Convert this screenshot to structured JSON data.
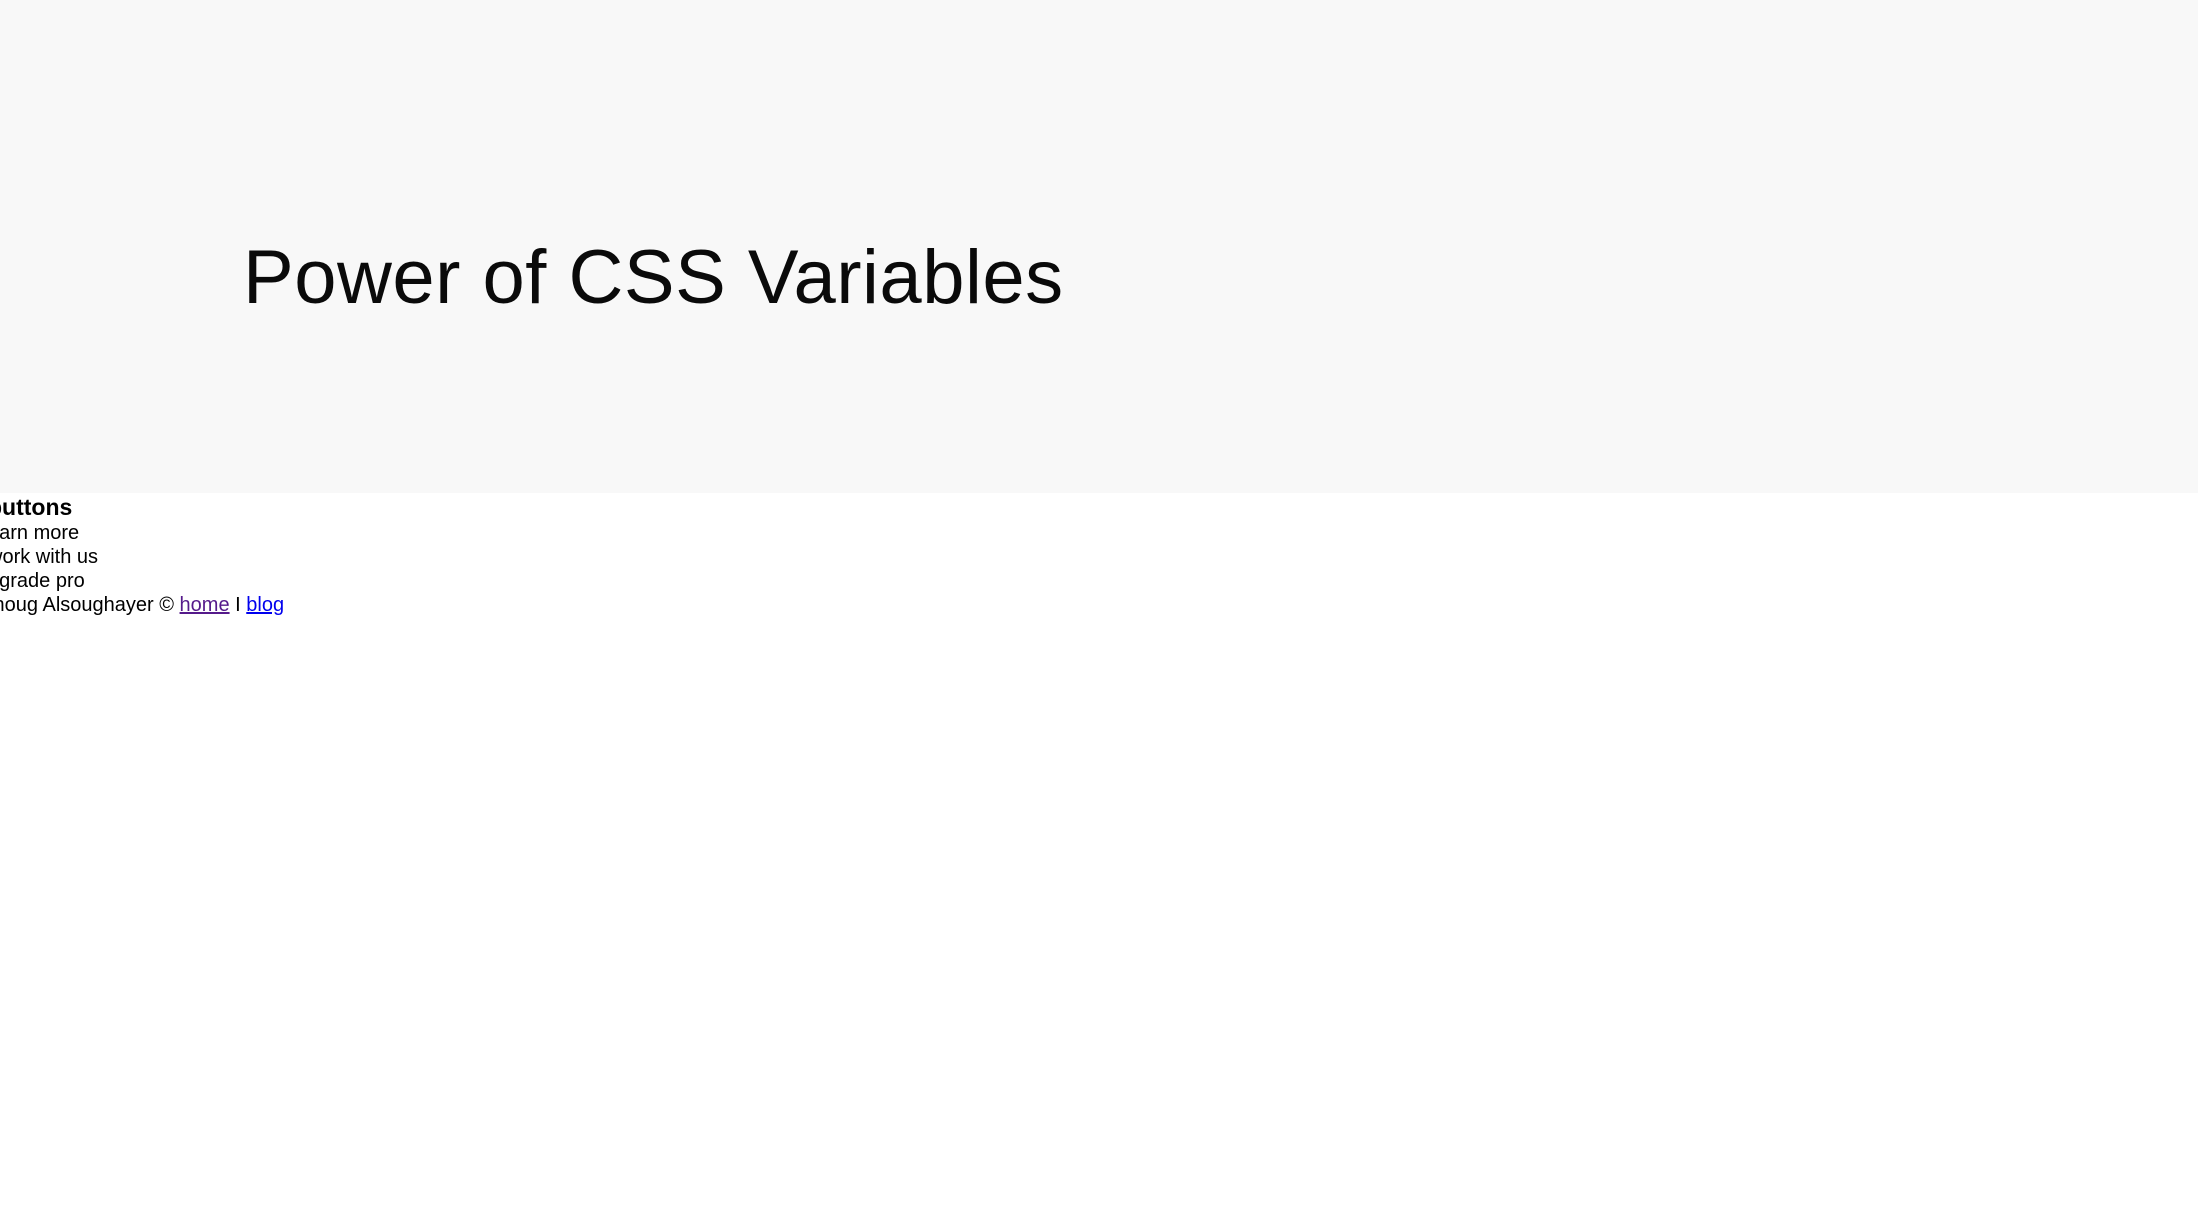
{
  "hero": {
    "title": "Power of CSS Variables"
  },
  "buttons_section": {
    "heading": "buttons",
    "items": [
      {
        "label": "earn more"
      },
      {
        "label": "work with us"
      },
      {
        "label": "pgrade pro"
      }
    ]
  },
  "footer": {
    "author_text": "thoug Alsoughayer ©",
    "home_link": "home",
    "separator": "I",
    "blog_link": "blog"
  },
  "colors": {
    "hero_background": "#f8f8f8",
    "link": "#0000ee",
    "visited_link": "#551a8b"
  }
}
